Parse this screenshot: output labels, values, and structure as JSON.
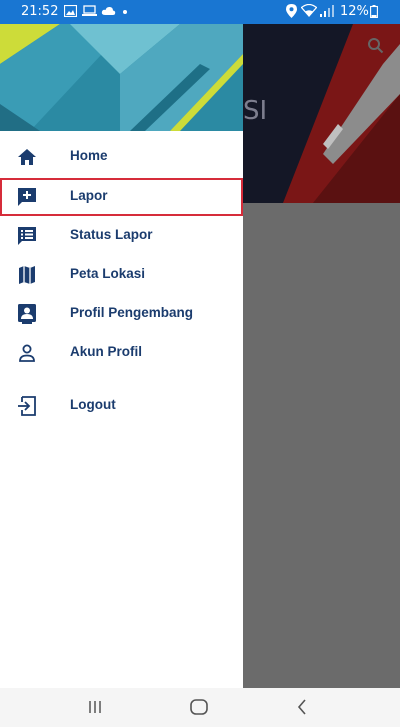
{
  "status_bar": {
    "time": "21:52",
    "battery": "12%",
    "background_color": "#1976d2"
  },
  "drawer": {
    "items": [
      {
        "label": "Home",
        "icon": "home-icon"
      },
      {
        "label": "Lapor",
        "icon": "add-comment-icon",
        "selected": true
      },
      {
        "label": "Status Lapor",
        "icon": "list-alt-icon"
      },
      {
        "label": "Peta Lokasi",
        "icon": "map-icon"
      },
      {
        "label": "Profil Pengembang",
        "icon": "contact-card-icon"
      },
      {
        "label": "Akun Profil",
        "icon": "person-icon"
      },
      {
        "label": "Logout",
        "icon": "logout-icon"
      }
    ],
    "label_color": "#1b3c6e",
    "selection_outline_color": "#d62c3a"
  },
  "background_app": {
    "title_fragment": "SI",
    "icon": "search-icon"
  },
  "nav_bar": {
    "buttons": [
      "recents-icon",
      "home-button-icon",
      "back-icon"
    ]
  }
}
